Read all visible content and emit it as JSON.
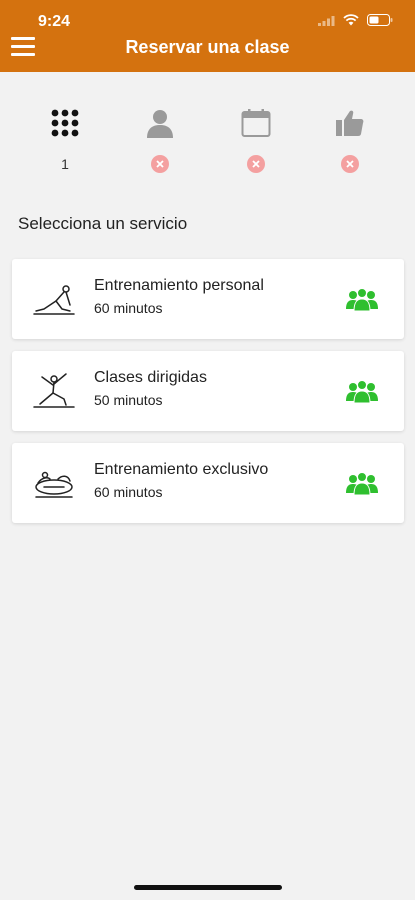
{
  "status_bar": {
    "time": "9:24"
  },
  "header": {
    "title": "Reservar una clase",
    "menu_icon": "hamburger-menu-icon"
  },
  "steps": [
    {
      "icon": "grid-icon",
      "status_text": "1",
      "state": "active"
    },
    {
      "icon": "user-icon",
      "state": "pending"
    },
    {
      "icon": "calendar-icon",
      "state": "pending"
    },
    {
      "icon": "thumbs-up-icon",
      "state": "pending"
    }
  ],
  "section": {
    "heading": "Selecciona un servicio"
  },
  "services": [
    {
      "name": "Entrenamiento personal",
      "duration": "60 minutos",
      "icon": "stretch-pose-icon"
    },
    {
      "name": "Clases dirigidas",
      "duration": "50 minutos",
      "icon": "lunge-pose-icon"
    },
    {
      "name": "Entrenamiento exclusivo",
      "duration": "60 minutos",
      "icon": "gym-equipment-icon"
    }
  ],
  "colors": {
    "accent": "#d4720f",
    "group_icon": "#2fbf2f",
    "pending_badge": "#f4a0a0",
    "background": "#f2f2f2"
  }
}
